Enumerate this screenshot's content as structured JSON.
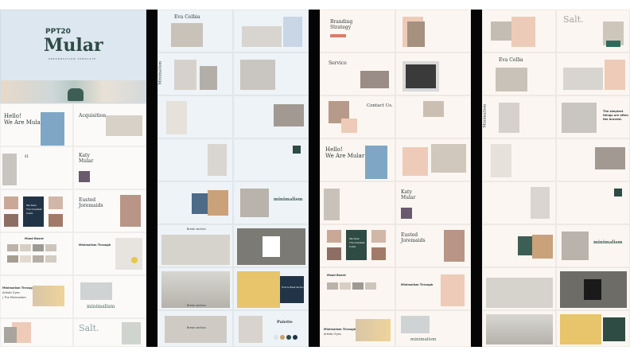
{
  "colors": {
    "col_bg_blue": "#dfe8ef",
    "col_bg_cream": "#f6ece4",
    "divider": "#050505",
    "accent_green": "#2e4b44",
    "accent_navy": "#213447",
    "accent_peach": "#eecbb8",
    "accent_gold": "#c7a36a"
  },
  "brand": {
    "logo_small": "PPT20",
    "title": "Mular",
    "subtitle": "PRESENTATION TEMPLATE"
  },
  "col1": {
    "hello": "Hello!",
    "we_are": "We Are Mular",
    "acquisition": "Acquisition",
    "katy": "Katy",
    "mular": "Mular",
    "we_deal": "We Deal",
    "the_greatest": "The Greatest",
    "costs": "Costs",
    "eusted": "Eusted",
    "journalis": "Joremaids",
    "mood_board": "Mood Board",
    "minimalism_through": "Minimalism Through",
    "artistic_eyes": "Artistic Eyes",
    "the_minimalism": "| The Minimalism",
    "minimalism": "minimalism",
    "salt": "Salt.",
    "section_num": "01"
  },
  "col2": {
    "eva": "Eva Celbia",
    "minimalism_v": "Minimalism",
    "palette": "Palette",
    "break_section": "Break section",
    "minimalism": "minimalism",
    "time_break": "Time to Break Section"
  },
  "col3": {
    "branding": "Branding",
    "strategy": "Strategy",
    "service": "Service",
    "contact": "Contact Us.",
    "hello": "Hello!",
    "we_are": "We Are Mular",
    "katy": "Katy",
    "mular": "Mular",
    "we_deal": "We Deal",
    "the_greatest": "The Greatest",
    "costs": "Costs",
    "eusted": "Eusted",
    "journalis": "Joremaids",
    "mood_board": "Mood Board",
    "minimalism_through": "Minimalism Through",
    "artistic_eyes": "Artistic Eyes",
    "minimalism": "minimalism"
  },
  "col4": {
    "salt": "Salt.",
    "eva": "Eva Cellia",
    "minimalism_v": "Minimalism",
    "the_simplest": "The simplest",
    "things_are": "things are often",
    "the_bravest": "the bravest.",
    "minimalism": "minimalism"
  }
}
